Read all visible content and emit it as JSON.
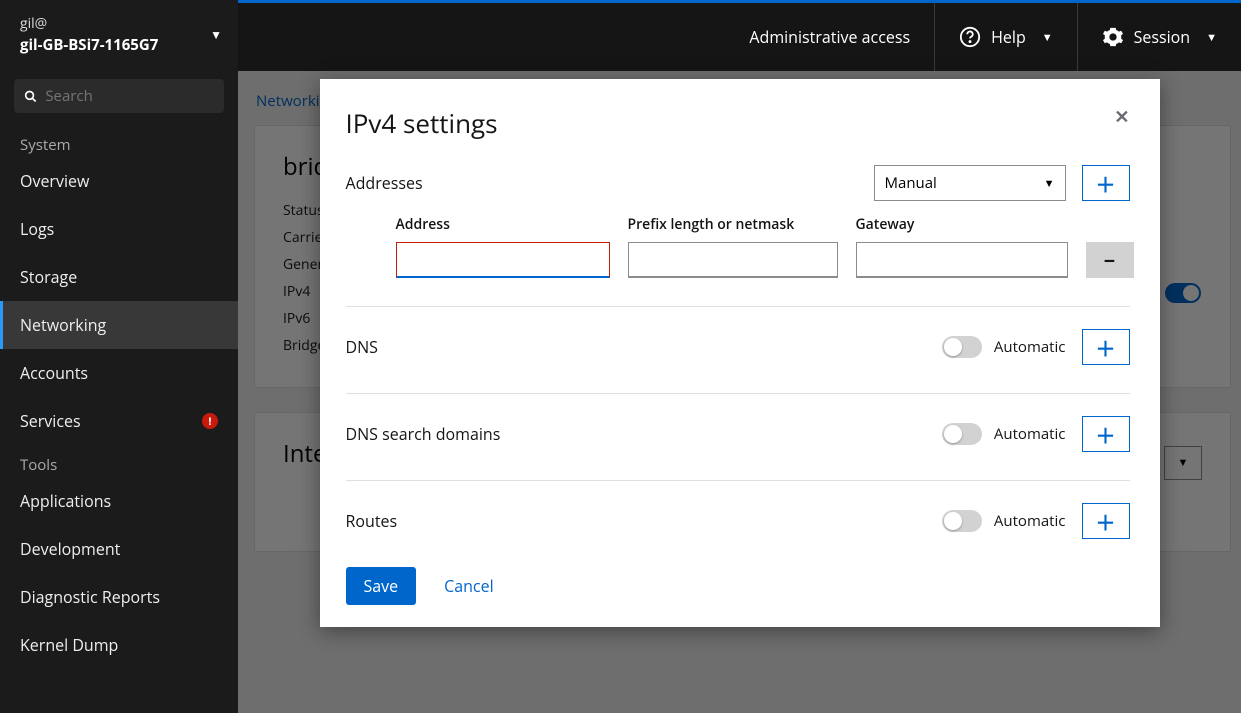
{
  "sidebar": {
    "user": "gil@",
    "host": "gil-GB-BSi7-1165G7",
    "search_placeholder": "Search",
    "section_system": "System",
    "items_system": [
      "Overview",
      "Logs",
      "Storage",
      "Networking",
      "Accounts",
      "Services"
    ],
    "section_tools": "Tools",
    "items_tools": [
      "Applications",
      "Development",
      "Diagnostic Reports",
      "Kernel Dump"
    ]
  },
  "topbar": {
    "admin": "Administrative access",
    "help": "Help",
    "session": "Session"
  },
  "page": {
    "breadcrumb": "Networking",
    "card_title": "bridge",
    "rows": [
      "Status",
      "Carrier",
      "General",
      "IPv4",
      "IPv6",
      "Bridge"
    ],
    "interfaces": "Interfaces"
  },
  "modal": {
    "title": "IPv4 settings",
    "addresses_label": "Addresses",
    "mode_options": [
      "Manual"
    ],
    "mode_selected": "Manual",
    "addr_address": "Address",
    "addr_prefix": "Prefix length or netmask",
    "addr_gateway": "Gateway",
    "addr_value": "",
    "prefix_value": "",
    "gateway_value": "",
    "dns_label": "DNS",
    "dnsd_label": "DNS search domains",
    "routes_label": "Routes",
    "automatic": "Automatic",
    "save": "Save",
    "cancel": "Cancel"
  }
}
